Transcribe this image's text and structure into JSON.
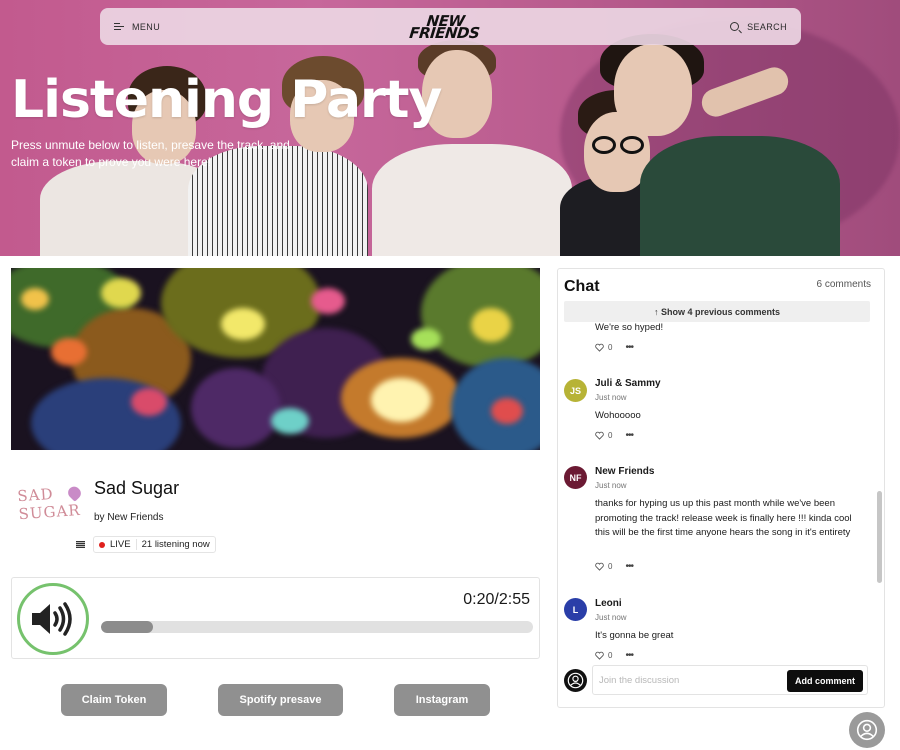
{
  "topbar": {
    "menu_label": "MENU",
    "logo_line1": "NEW",
    "logo_line2": "FRIENDS",
    "search_label": "SEARCH"
  },
  "hero": {
    "title": "Listening Party",
    "subtitle": "Press unmute below to listen, presave the track, and claim a token to prove you were here!"
  },
  "track": {
    "art_text_line1": "SAD",
    "art_text_line2": "SUGAR",
    "title": "Sad Sugar",
    "artist": "by New Friends",
    "live_label": "LIVE",
    "listeners": "21 listening now"
  },
  "player": {
    "time_current": "0:20",
    "time_separator": "/",
    "time_total": "2:55",
    "progress": 0.12,
    "icon": "speaker-icon"
  },
  "actions": {
    "claim_token": "Claim Token",
    "spotify_presave": "Spotify presave",
    "instagram": "Instagram"
  },
  "chat": {
    "title": "Chat",
    "count": "6 comments",
    "show_previous": "↑ Show 4 previous comments",
    "partial_message": "We're so hyped!",
    "partial_likes": "0",
    "messages": [
      {
        "initials": "JS",
        "name": "Juli & Sammy",
        "time": "Just now",
        "body": "Wohooooo",
        "likes": "0",
        "color": "#b7b336"
      },
      {
        "initials": "NF",
        "name": "New Friends",
        "time": "Just now",
        "body": "thanks for hyping us up this past month while we've been promoting the track! release week is finally here !!! kinda cool this will be the first time anyone hears the song in it's entirety",
        "likes": "0",
        "color": "#6b1a33"
      },
      {
        "initials": "L",
        "name": "Leoni",
        "time": "Just now",
        "body": "It's gonna be great",
        "likes": "0",
        "color": "#2a3ea8"
      }
    ],
    "input_placeholder": "Join the discussion",
    "add_comment": "Add comment"
  },
  "colors": {
    "hero_pink": "#c25a8e",
    "unmute_ring": "#76c26d",
    "live_red": "#e0201c",
    "button_gray": "#909090"
  }
}
